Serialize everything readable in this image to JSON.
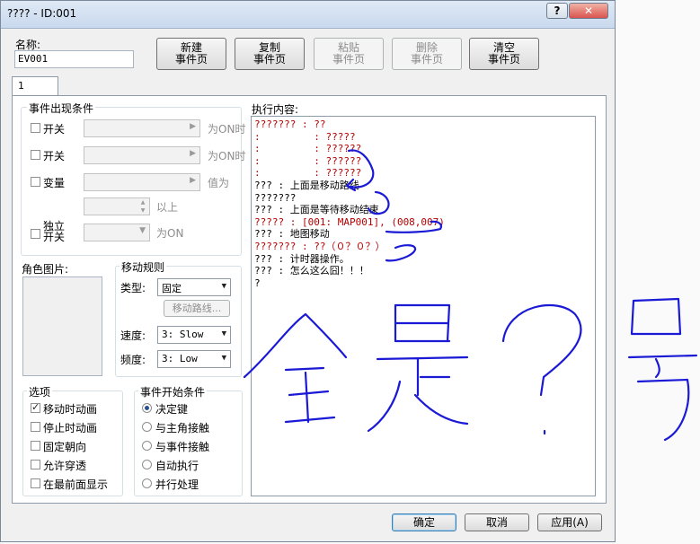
{
  "window": {
    "title": "???? - ID:001",
    "help_btn": "?",
    "close_btn": "✕"
  },
  "name": {
    "label": "名称:",
    "value": "EV001"
  },
  "toolbar": [
    {
      "line1": "新建",
      "line2": "事件页",
      "enabled": true
    },
    {
      "line1": "复制",
      "line2": "事件页",
      "enabled": true
    },
    {
      "line1": "粘贴",
      "line2": "事件页",
      "enabled": false
    },
    {
      "line1": "删除",
      "line2": "事件页",
      "enabled": false
    },
    {
      "line1": "清空",
      "line2": "事件页",
      "enabled": true
    }
  ],
  "tab": {
    "label": "1"
  },
  "conditions": {
    "title": "事件出现条件",
    "switch1": {
      "label": "开关",
      "suffix": "为ON时"
    },
    "switch2": {
      "label": "开关",
      "suffix": "为ON时"
    },
    "variable": {
      "label": "变量",
      "suffix": "值为",
      "above": "以上"
    },
    "self_switch": {
      "label_line1": "独立",
      "label_line2": "开关",
      "suffix": "为ON"
    }
  },
  "graphic": {
    "label": "角色图片:"
  },
  "movement": {
    "title": "移动规则",
    "type_label": "类型:",
    "type_value": "固定",
    "route_button": "移动路线...",
    "speed_label": "速度:",
    "speed_value": "3: Slow",
    "freq_label": "频度:",
    "freq_value": "3: Low"
  },
  "options": {
    "title": "选项",
    "items": [
      {
        "label": "移动时动画",
        "checked": true
      },
      {
        "label": "停止时动画",
        "checked": false
      },
      {
        "label": "固定朝向",
        "checked": false
      },
      {
        "label": "允许穿透",
        "checked": false
      },
      {
        "label": "在最前面显示",
        "checked": false
      }
    ]
  },
  "trigger": {
    "title": "事件开始条件",
    "items": [
      {
        "label": "决定键",
        "checked": true
      },
      {
        "label": "与主角接触",
        "checked": false
      },
      {
        "label": "与事件接触",
        "checked": false
      },
      {
        "label": "自动执行",
        "checked": false
      },
      {
        "label": "并行处理",
        "checked": false
      }
    ]
  },
  "execution": {
    "label": "执行内容:",
    "lines": [
      {
        "text": "??????? : ??",
        "color": "red"
      },
      {
        "text": ":         : ?????",
        "color": "red"
      },
      {
        "text": ":         : ??????",
        "color": "red"
      },
      {
        "text": ":         : ??????",
        "color": "red"
      },
      {
        "text": ":         : ??????",
        "color": "red"
      },
      {
        "text": "??? : 上面是移动路线",
        "color": "black"
      },
      {
        "text": "???????",
        "color": "black"
      },
      {
        "text": "??? : 上面是等待移动结束",
        "color": "black"
      },
      {
        "text": "????? : [001: MAP001], (008,007)",
        "color": "red"
      },
      {
        "text": "??? : 地图移动",
        "color": "black"
      },
      {
        "text": "??????? : ??（０？０？）",
        "color": "red"
      },
      {
        "text": "??? : 计时器操作。",
        "color": "black"
      },
      {
        "text": "??? : 怎么这么囧！！！",
        "color": "black"
      },
      {
        "text": "?",
        "color": "black"
      }
    ]
  },
  "footer": {
    "ok": "确定",
    "cancel": "取消",
    "apply": "应用(A)"
  },
  "colors": {
    "annotation": "#1a1ad6",
    "error_text": "#b50000"
  }
}
